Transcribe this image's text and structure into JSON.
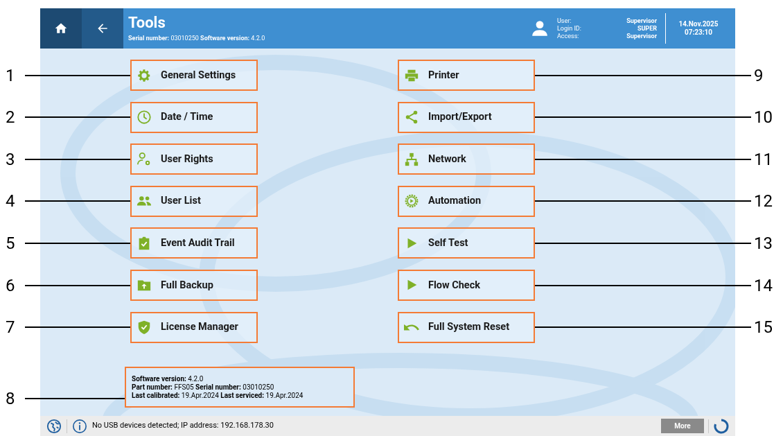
{
  "header": {
    "title": "Tools",
    "subtitle": "**Serial number:** 03010250 **Software version:** 4.2.0",
    "user_labels": [
      "User:",
      "Login ID:",
      "Access:"
    ],
    "user_values": [
      "Supervisor",
      "SUPER",
      "Supervisor"
    ],
    "date": "14.Nov.2025",
    "time": "07:23:10"
  },
  "tools_left": [
    {
      "label": "General Settings",
      "kind": "gear",
      "callout": "1"
    },
    {
      "label": "Date / Time",
      "kind": "clock",
      "callout": "2"
    },
    {
      "label": "User Rights",
      "kind": "user-gear",
      "callout": "3"
    },
    {
      "label": "User List",
      "kind": "users",
      "callout": "4"
    },
    {
      "label": "Event Audit Trail",
      "kind": "clipboard",
      "callout": "5"
    },
    {
      "label": "Full Backup",
      "kind": "folder-upload",
      "callout": "6"
    },
    {
      "label": "License Manager",
      "kind": "shield",
      "callout": "7"
    }
  ],
  "tools_right": [
    {
      "label": "Printer",
      "kind": "printer",
      "callout": "9"
    },
    {
      "label": "Import/Export",
      "kind": "share",
      "callout": "10"
    },
    {
      "label": "Network",
      "kind": "network",
      "callout": "11"
    },
    {
      "label": "Automation",
      "kind": "automation",
      "callout": "12"
    },
    {
      "label": "Self Test",
      "kind": "play",
      "callout": "13"
    },
    {
      "label": "Flow Check",
      "kind": "play",
      "callout": "14"
    },
    {
      "label": "Full System Reset",
      "kind": "undo",
      "callout": "15"
    }
  ],
  "info_box": {
    "callout": "8",
    "lines": [
      "**Software version:** 4.2.0",
      "**Part number:** FFS05 **Serial number:** 03010250",
      "**Last calibrated:** 19.Apr.2024 **Last serviced:** 19.Apr.2024"
    ]
  },
  "status_bar": {
    "message": "No USB devices detected; IP address: 192.168.178.30",
    "more_button": "More"
  }
}
